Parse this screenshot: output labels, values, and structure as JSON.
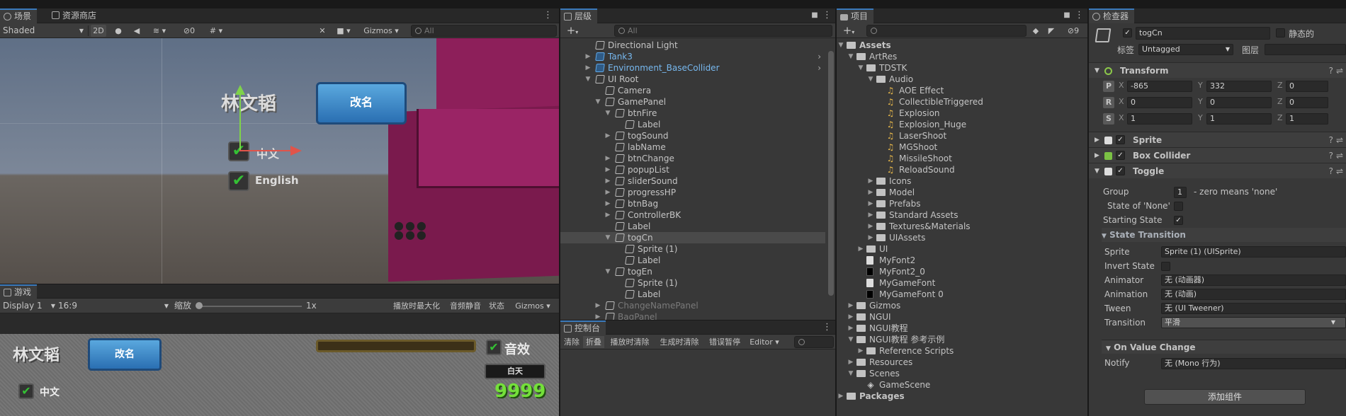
{
  "scene": {
    "tab_label": "场景",
    "tab2_label": "资源商店",
    "shading": "Shaded",
    "btn_2d": "2D",
    "hidden_count": "0",
    "gizmos": "Gizmos",
    "search_placeholder": "All",
    "title_text": "林文韬",
    "rename_button": "改名",
    "cn_label": "中文",
    "en_label": "English"
  },
  "game": {
    "tab_label": "游戏",
    "display": "Display 1",
    "aspect": "16:9",
    "scale_label": "缩放",
    "scale_value": "1x",
    "maximize": "播放时最大化",
    "mute": "音频静音",
    "stats": "状态",
    "gizmos": "Gizmos",
    "title_text": "林文韬",
    "rename_button": "改名",
    "sound_label": "音效",
    "button_label": "白天",
    "score": "9999",
    "cn_label": "中文"
  },
  "hierarchy": {
    "tab_label": "层级",
    "add": "+",
    "search_placeholder": "All",
    "rows": [
      {
        "label": "Directional Light",
        "depth": 0,
        "arrow": ""
      },
      {
        "label": "Tank3",
        "depth": 0,
        "arrow": "right",
        "prefab": true
      },
      {
        "label": "Environment_BaseCollider",
        "depth": 0,
        "arrow": "right",
        "prefab": true
      },
      {
        "label": "UI Root",
        "depth": 0,
        "arrow": "down"
      },
      {
        "label": "Camera",
        "depth": 1,
        "arrow": ""
      },
      {
        "label": "GamePanel",
        "depth": 1,
        "arrow": "down"
      },
      {
        "label": "btnFire",
        "depth": 2,
        "arrow": "down"
      },
      {
        "label": "Label",
        "depth": 3,
        "arrow": ""
      },
      {
        "label": "togSound",
        "depth": 2,
        "arrow": "right"
      },
      {
        "label": "labName",
        "depth": 2,
        "arrow": ""
      },
      {
        "label": "btnChange",
        "depth": 2,
        "arrow": "right"
      },
      {
        "label": "popupList",
        "depth": 2,
        "arrow": "right"
      },
      {
        "label": "sliderSound",
        "depth": 2,
        "arrow": "right"
      },
      {
        "label": "progressHP",
        "depth": 2,
        "arrow": "right"
      },
      {
        "label": "btnBag",
        "depth": 2,
        "arrow": "right"
      },
      {
        "label": "ControllerBK",
        "depth": 2,
        "arrow": "right"
      },
      {
        "label": "Label",
        "depth": 2,
        "arrow": ""
      },
      {
        "label": "togCn",
        "depth": 2,
        "arrow": "down",
        "selected": true
      },
      {
        "label": "Sprite (1)",
        "depth": 3,
        "arrow": ""
      },
      {
        "label": "Label",
        "depth": 3,
        "arrow": ""
      },
      {
        "label": "togEn",
        "depth": 2,
        "arrow": "down"
      },
      {
        "label": "Sprite (1)",
        "depth": 3,
        "arrow": ""
      },
      {
        "label": "Label",
        "depth": 3,
        "arrow": ""
      },
      {
        "label": "ChangeNamePanel",
        "depth": 1,
        "arrow": "right",
        "dim": true
      },
      {
        "label": "BagPanel",
        "depth": 1,
        "arrow": "right",
        "dim": true
      }
    ]
  },
  "console": {
    "tab_label": "控制台",
    "clear": "清除",
    "collapse": "折叠",
    "clear_on_play": "播放时清除",
    "clear_on_build": "生成时清除",
    "error_pause": "错误暂停",
    "editor": "Editor"
  },
  "project": {
    "tab_label": "项目",
    "add": "+",
    "hidden_count": "9",
    "rows": [
      {
        "label": "Assets",
        "depth": 0,
        "arrow": "down",
        "icon": "folder",
        "bold": true
      },
      {
        "label": "ArtRes",
        "depth": 1,
        "arrow": "down",
        "icon": "folder"
      },
      {
        "label": "TDSTK",
        "depth": 2,
        "arrow": "down",
        "icon": "folder"
      },
      {
        "label": "Audio",
        "depth": 3,
        "arrow": "down",
        "icon": "folder"
      },
      {
        "label": "AOE Effect",
        "depth": 4,
        "arrow": "",
        "icon": "audio"
      },
      {
        "label": "CollectibleTriggered",
        "depth": 4,
        "arrow": "",
        "icon": "audio"
      },
      {
        "label": "Explosion",
        "depth": 4,
        "arrow": "",
        "icon": "audio"
      },
      {
        "label": "Explosion_Huge",
        "depth": 4,
        "arrow": "",
        "icon": "audio"
      },
      {
        "label": "LaserShoot",
        "depth": 4,
        "arrow": "",
        "icon": "audio"
      },
      {
        "label": "MGShoot",
        "depth": 4,
        "arrow": "",
        "icon": "audio"
      },
      {
        "label": "MissileShoot",
        "depth": 4,
        "arrow": "",
        "icon": "audio"
      },
      {
        "label": "ReloadSound",
        "depth": 4,
        "arrow": "",
        "icon": "audio"
      },
      {
        "label": "Icons",
        "depth": 3,
        "arrow": "right",
        "icon": "folder"
      },
      {
        "label": "Model",
        "depth": 3,
        "arrow": "right",
        "icon": "folder"
      },
      {
        "label": "Prefabs",
        "depth": 3,
        "arrow": "right",
        "icon": "folder"
      },
      {
        "label": "Standard Assets",
        "depth": 3,
        "arrow": "right",
        "icon": "folder"
      },
      {
        "label": "Textures&Materials",
        "depth": 3,
        "arrow": "right",
        "icon": "folder"
      },
      {
        "label": "UIAssets",
        "depth": 3,
        "arrow": "right",
        "icon": "folder"
      },
      {
        "label": "UI",
        "depth": 2,
        "arrow": "right",
        "icon": "folder"
      },
      {
        "label": "MyFont2",
        "depth": 2,
        "arrow": "",
        "icon": "doc"
      },
      {
        "label": "MyFont2_0",
        "depth": 2,
        "arrow": "",
        "icon": "black"
      },
      {
        "label": "MyGameFont",
        "depth": 2,
        "arrow": "",
        "icon": "doc"
      },
      {
        "label": "MyGameFont 0",
        "depth": 2,
        "arrow": "",
        "icon": "black"
      },
      {
        "label": "Gizmos",
        "depth": 1,
        "arrow": "right",
        "icon": "folder"
      },
      {
        "label": "NGUI",
        "depth": 1,
        "arrow": "right",
        "icon": "folder"
      },
      {
        "label": "NGUI教程",
        "depth": 1,
        "arrow": "right",
        "icon": "folder"
      },
      {
        "label": "NGUI教程 参考示例",
        "depth": 1,
        "arrow": "down",
        "icon": "folder"
      },
      {
        "label": "Reference Scripts",
        "depth": 2,
        "arrow": "right",
        "icon": "folder"
      },
      {
        "label": "Resources",
        "depth": 1,
        "arrow": "right",
        "icon": "folder"
      },
      {
        "label": "Scenes",
        "depth": 1,
        "arrow": "down",
        "icon": "folder"
      },
      {
        "label": "GameScene",
        "depth": 2,
        "arrow": "",
        "icon": "unity"
      },
      {
        "label": "Packages",
        "depth": 0,
        "arrow": "right",
        "icon": "folder",
        "bold": true
      }
    ]
  },
  "inspector": {
    "tab_label": "检查器",
    "object_name": "togCn",
    "static_label": "静态的",
    "tag_label": "标签",
    "tag_value": "Untagged",
    "layer_label": "图层",
    "transform": {
      "title": "Transform",
      "p": [
        "-865",
        "332",
        "0"
      ],
      "r": [
        "0",
        "0",
        "0"
      ],
      "s": [
        "1",
        "1",
        "1"
      ],
      "p_label": "P",
      "r_label": "R",
      "s_label": "S",
      "x": "X",
      "y": "Y",
      "z": "Z"
    },
    "sprite_title": "Sprite",
    "box_title": "Box Collider",
    "toggle_title": "Toggle",
    "group_label": "Group",
    "group_value": "1",
    "group_hint": "- zero means 'none'",
    "state_none_label": "State of 'None'",
    "starting_label": "Starting State",
    "state_transition": "State Transition",
    "sprite_label": "Sprite",
    "sprite_value": "Sprite (1) (UISprite)",
    "invert_label": "Invert State",
    "animator_label": "Animator",
    "animator_value": "无 (动画器)",
    "animation_label": "Animation",
    "animation_value": "无 (动画)",
    "tween_label": "Tween",
    "tween_value": "无 (UI Tweener)",
    "transition_label": "Transition",
    "transition_value": "平滑",
    "on_value_change": "On Value Change",
    "notify_label": "Notify",
    "notify_value": "无 (Mono 行为)",
    "add_component": "添加组件"
  }
}
